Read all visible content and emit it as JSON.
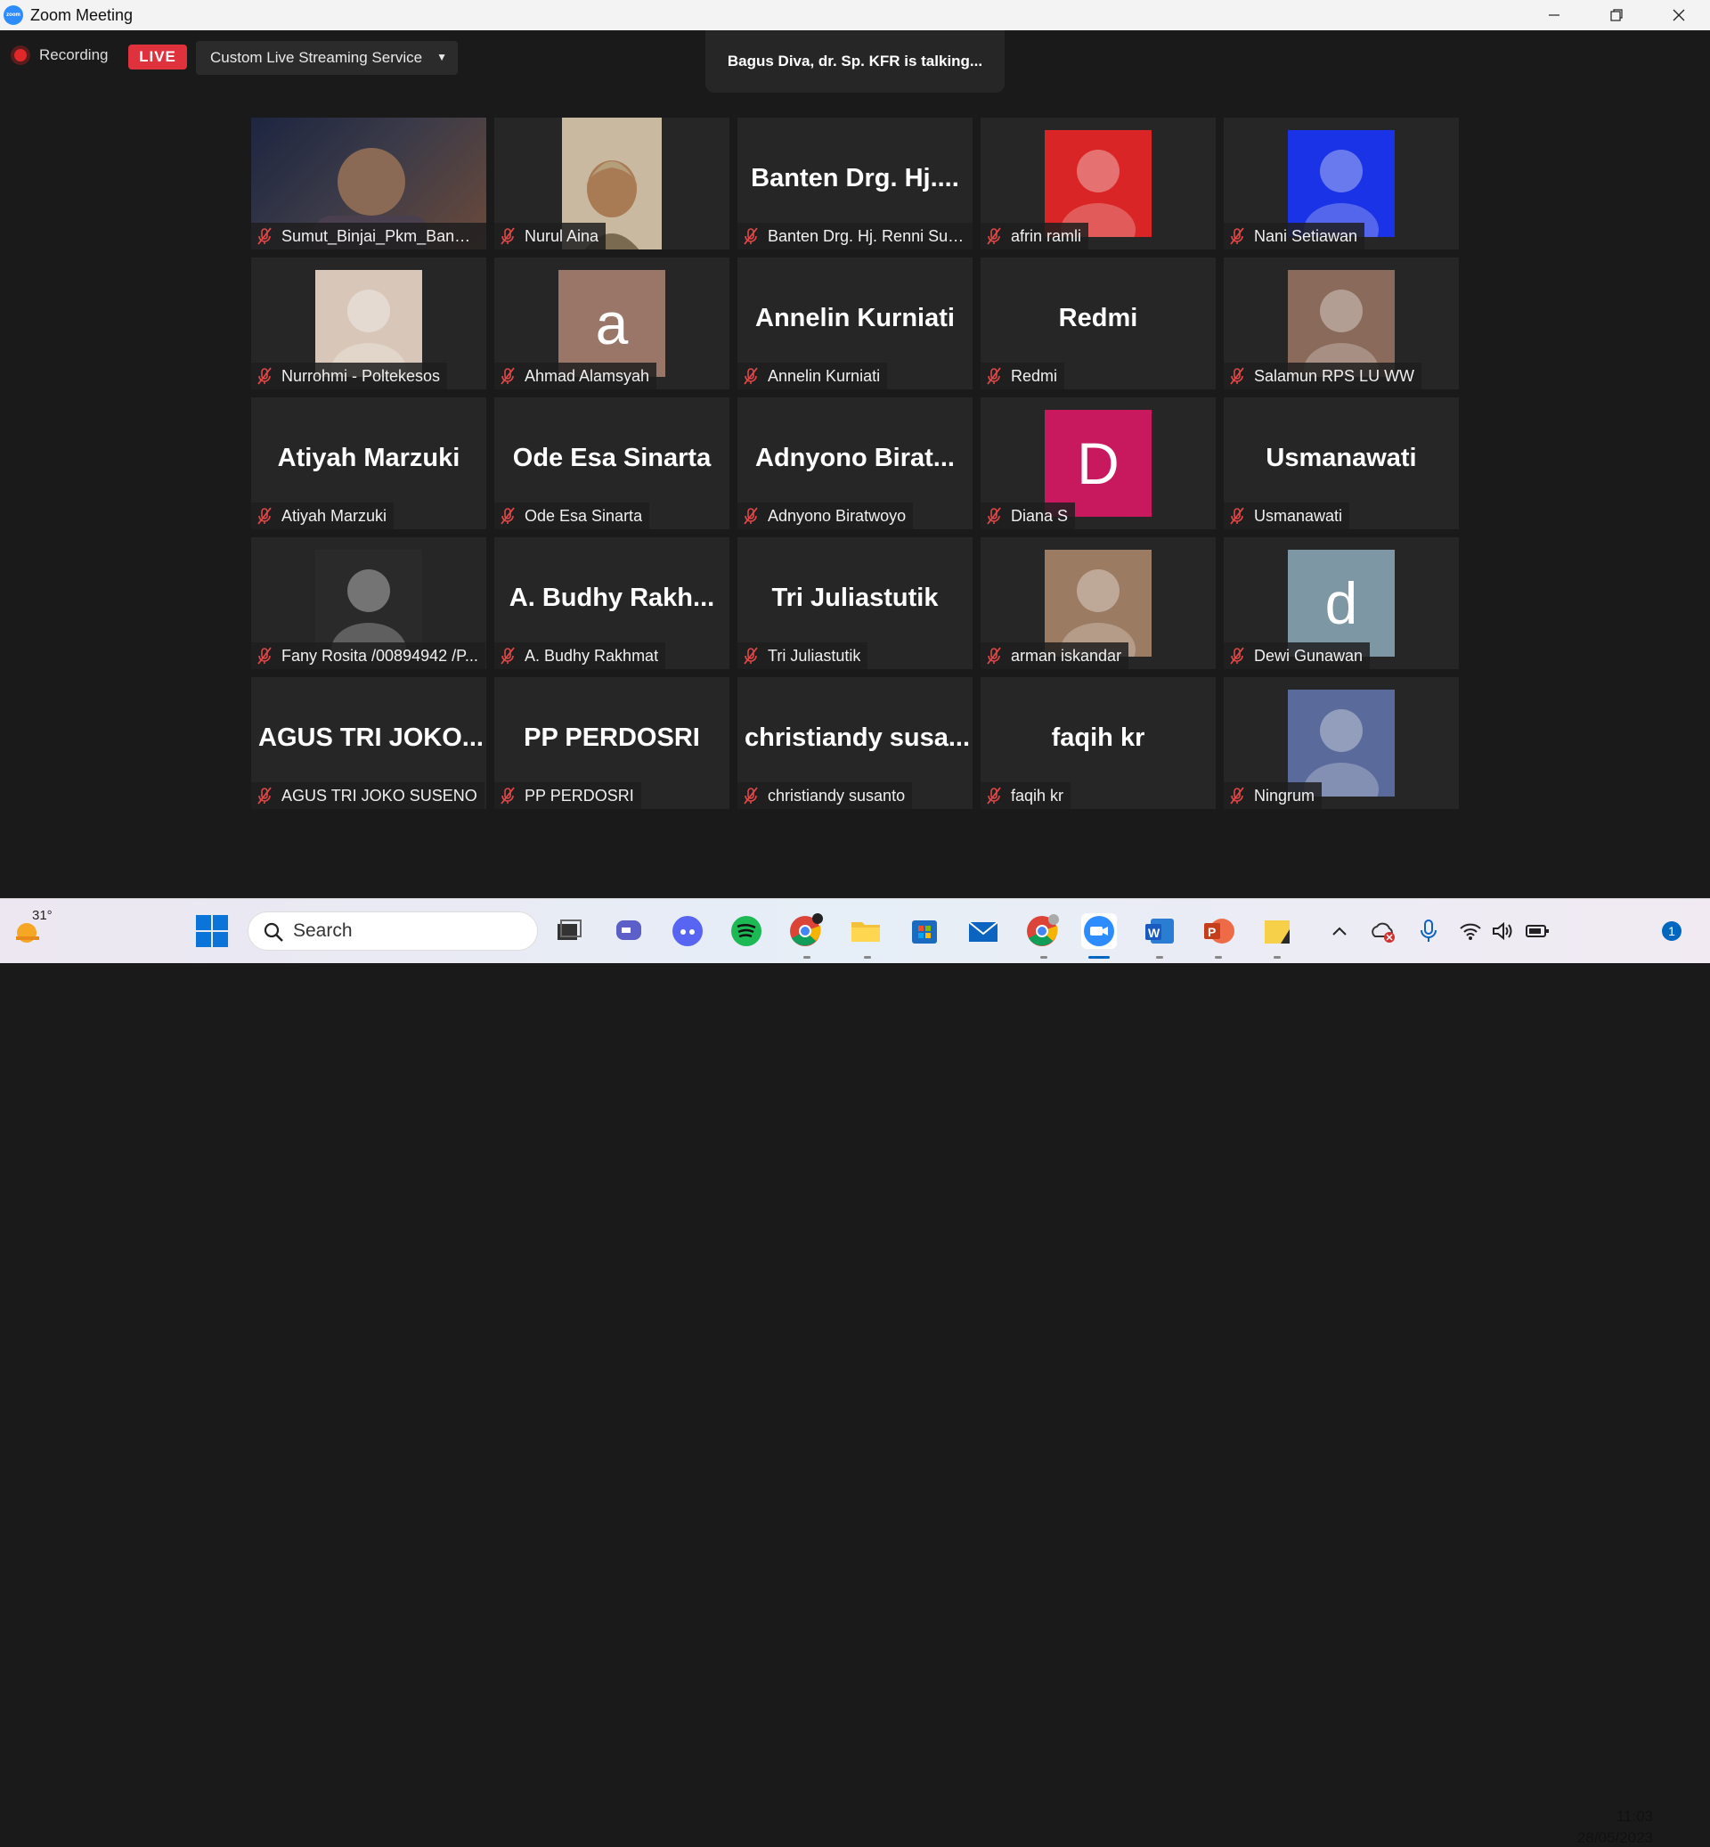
{
  "window": {
    "title": "Zoom Meeting",
    "app_icon": "zoom-logo",
    "logo_text": "zoom"
  },
  "top_bar": {
    "recording_label": "Recording",
    "live_label": "LIVE",
    "stream_service": "Custom Live Streaming Service",
    "talking_notice": "Bagus Diva, dr. Sp. KFR is talking..."
  },
  "participants": [
    {
      "big_name": "",
      "name": "Sumut_Binjai_Pkm_Banda...",
      "type": "video",
      "color": "#3a3a48"
    },
    {
      "big_name": "",
      "name": "Nurul Aina",
      "type": "portrait",
      "color": "#c9b9a0"
    },
    {
      "big_name": "Banten  Drg.  Hj....",
      "name": "Banten Drg. Hj. Renni Sus...",
      "type": "name"
    },
    {
      "big_name": "",
      "name": "afrin ramli",
      "type": "image",
      "color": "#d92525"
    },
    {
      "big_name": "",
      "name": "Nani Setiawan",
      "type": "image",
      "color": "#1a33e6"
    },
    {
      "big_name": "",
      "name": "Nurrohmi - Poltekesos",
      "type": "image",
      "color": "#d8c7b8"
    },
    {
      "big_name": "",
      "name": "Ahmad Alamsyah",
      "type": "letter",
      "letter": "a",
      "color": "#9a7668"
    },
    {
      "big_name": "Annelin Kurniati",
      "name": "Annelin Kurniati",
      "type": "name"
    },
    {
      "big_name": "Redmi",
      "name": "Redmi",
      "type": "name"
    },
    {
      "big_name": "",
      "name": "Salamun RPS LU WW",
      "type": "image",
      "color": "#8a6a5a"
    },
    {
      "big_name": "Atiyah Marzuki",
      "name": "Atiyah Marzuki",
      "type": "name"
    },
    {
      "big_name": "Ode Esa Sinarta",
      "name": "Ode Esa Sinarta",
      "type": "name"
    },
    {
      "big_name": "Adnyono  Birat...",
      "name": "Adnyono Biratwoyo",
      "type": "name"
    },
    {
      "big_name": "",
      "name": "Diana S",
      "type": "letter",
      "letter": "D",
      "color": "#c8185e"
    },
    {
      "big_name": "Usmanawati",
      "name": "Usmanawati",
      "type": "name"
    },
    {
      "big_name": "",
      "name": "Fany Rosita /00894942 /P...",
      "type": "image",
      "color": "#2a2a2a"
    },
    {
      "big_name": "A.  Budhy  Rakh...",
      "name": "A. Budhy Rakhmat",
      "type": "name"
    },
    {
      "big_name": "Tri Juliastutik",
      "name": "Tri Juliastutik",
      "type": "name"
    },
    {
      "big_name": "",
      "name": "arman iskandar",
      "type": "image",
      "color": "#9b7b62"
    },
    {
      "big_name": "",
      "name": "Dewi Gunawan",
      "type": "letter",
      "letter": "d",
      "color": "#7e97a5"
    },
    {
      "big_name": "AGUS  TRI  JOKO...",
      "name": "AGUS TRI JOKO SUSENO",
      "type": "name"
    },
    {
      "big_name": "PP PERDOSRI",
      "name": "PP PERDOSRI",
      "type": "name"
    },
    {
      "big_name": "christiandy  susa...",
      "name": "christiandy susanto",
      "type": "name"
    },
    {
      "big_name": "faqih kr",
      "name": "faqih kr",
      "type": "name"
    },
    {
      "big_name": "",
      "name": "Ningrum",
      "type": "image",
      "color": "#5a6a9a"
    }
  ],
  "taskbar": {
    "weather_temp": "31°",
    "search_placeholder": "Search",
    "time": "11:03",
    "date": "28/05/2023",
    "notification_count": "1"
  }
}
